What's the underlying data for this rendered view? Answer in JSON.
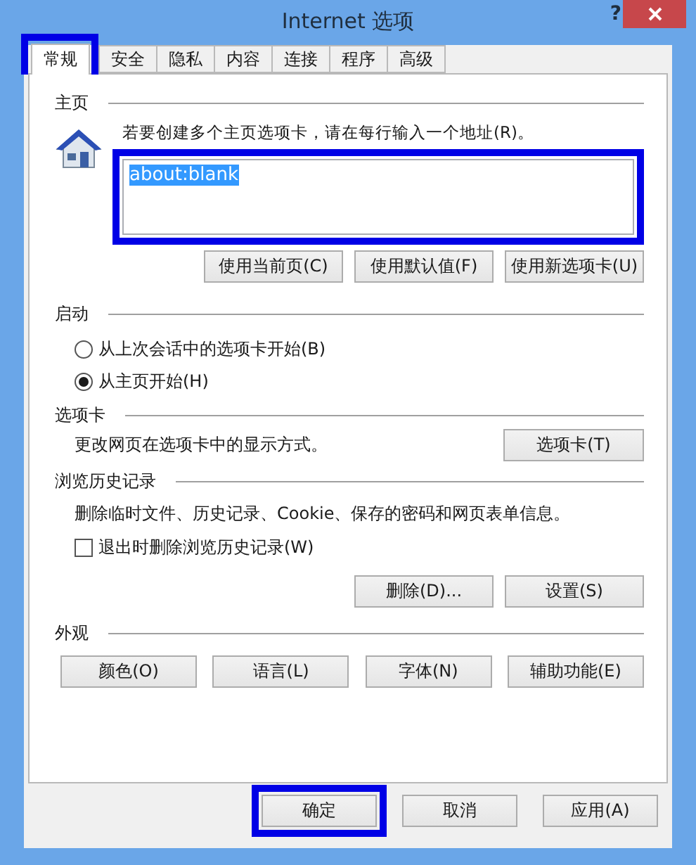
{
  "window": {
    "title": "Internet 选项",
    "help": "?"
  },
  "tabs": [
    {
      "label": "常规",
      "selected": true,
      "highlighted": true
    },
    {
      "label": "安全",
      "selected": false,
      "highlighted": false
    },
    {
      "label": "隐私",
      "selected": false,
      "highlighted": false
    },
    {
      "label": "内容",
      "selected": false,
      "highlighted": false
    },
    {
      "label": "连接",
      "selected": false,
      "highlighted": false
    },
    {
      "label": "程序",
      "selected": false,
      "highlighted": false
    },
    {
      "label": "高级",
      "selected": false,
      "highlighted": false
    }
  ],
  "homepage": {
    "title": "主页",
    "description": "若要创建多个主页选项卡，请在每行输入一个地址(R)。",
    "value": "about:blank",
    "highlighted": true,
    "buttons": [
      "使用当前页(C)",
      "使用默认值(F)",
      "使用新选项卡(U)"
    ]
  },
  "startup": {
    "title": "启动",
    "options": [
      {
        "label": "从上次会话中的选项卡开始(B)",
        "selected": false
      },
      {
        "label": "从主页开始(H)",
        "selected": true
      }
    ]
  },
  "tabs_section": {
    "title": "选项卡",
    "description": "更改网页在选项卡中的显示方式。",
    "button": "选项卡(T)"
  },
  "history": {
    "title": "浏览历史记录",
    "description": "删除临时文件、历史记录、Cookie、保存的密码和网页表单信息。",
    "checkbox": {
      "label": "退出时删除浏览历史记录(W)",
      "checked": false
    },
    "buttons": [
      "删除(D)...",
      "设置(S)"
    ]
  },
  "appearance": {
    "title": "外观",
    "buttons": [
      "颜色(O)",
      "语言(L)",
      "字体(N)",
      "辅助功能(E)"
    ]
  },
  "footer_buttons": [
    {
      "label": "确定",
      "highlighted": true
    },
    {
      "label": "取消",
      "highlighted": false
    },
    {
      "label": "应用(A)",
      "highlighted": false
    }
  ]
}
